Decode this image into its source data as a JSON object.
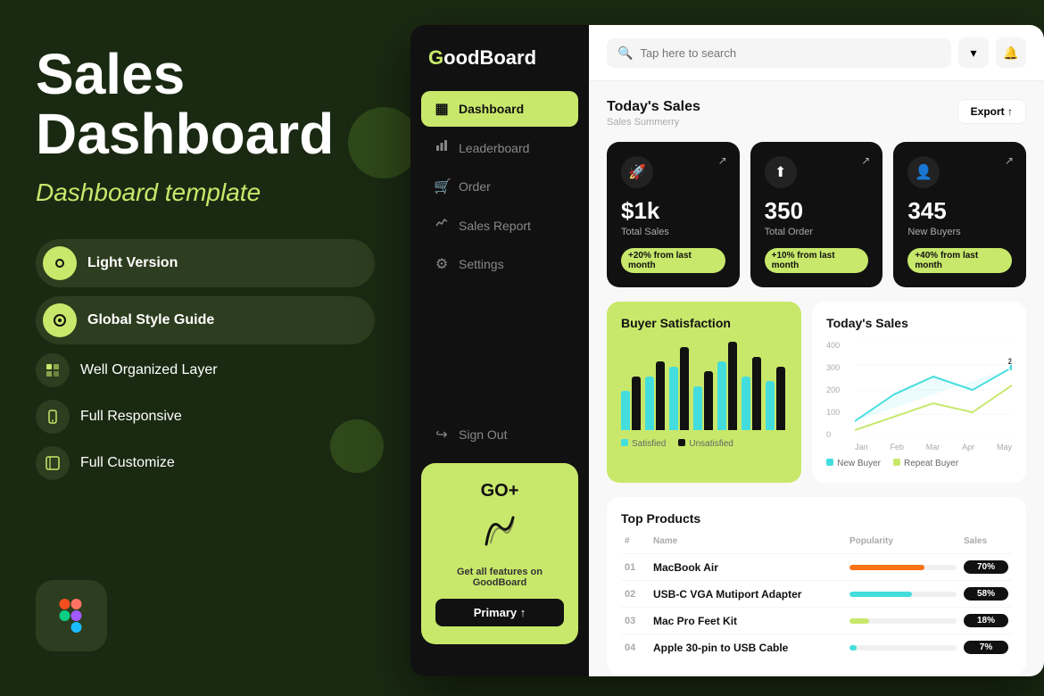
{
  "hero": {
    "title": "Sales\nDashboard",
    "subtitle": "Dashboard template",
    "features": [
      {
        "id": "light-version",
        "label": "Light Version",
        "icon": "⊙",
        "is_button": true
      },
      {
        "id": "global-style",
        "label": "Global Style Guide",
        "icon": "◎",
        "is_button": true
      },
      {
        "id": "organized",
        "label": "Well Organized Layer",
        "icon": "⊞"
      },
      {
        "id": "responsive",
        "label": "Full Responsive",
        "icon": "📱"
      },
      {
        "id": "customize",
        "label": "Full Customize",
        "icon": "⊡"
      }
    ]
  },
  "sidebar": {
    "logo": "GoodBoard",
    "nav_items": [
      {
        "id": "dashboard",
        "label": "Dashboard",
        "icon": "▦",
        "active": true
      },
      {
        "id": "leaderboard",
        "label": "Leaderboard",
        "icon": "📊",
        "active": false
      },
      {
        "id": "order",
        "label": "Order",
        "icon": "🛒",
        "active": false
      },
      {
        "id": "sales-report",
        "label": "Sales Report",
        "icon": "📈",
        "active": false
      },
      {
        "id": "settings",
        "label": "Settings",
        "icon": "⚙",
        "active": false
      }
    ],
    "signout": {
      "label": "Sign Out",
      "icon": "↪"
    },
    "promo": {
      "logo": "GO+",
      "icon": "✦",
      "text": "Get all features on GoodBoard",
      "button_label": "Primary ↑"
    }
  },
  "topbar": {
    "search_placeholder": "Tap here to search"
  },
  "dashboard": {
    "section_title": "Today's Sales",
    "section_sub": "Sales Summerry",
    "export_label": "Export ↑",
    "stats": [
      {
        "id": "total-sales",
        "icon": "🚀",
        "value": "$1k",
        "label": "Total Sales",
        "badge": "+20% from last month"
      },
      {
        "id": "total-order",
        "icon": "⬆",
        "value": "350",
        "label": "Total Order",
        "badge": "+10% from last month"
      },
      {
        "id": "new-buyers",
        "icon": "👤",
        "value": "345",
        "label": "New Buyers",
        "badge": "+40% from last month"
      }
    ],
    "buyer_satisfaction": {
      "title": "Buyer Satisfaction",
      "bars": [
        {
          "dark": 55,
          "teal": 40
        },
        {
          "dark": 70,
          "teal": 55
        },
        {
          "dark": 85,
          "teal": 65
        },
        {
          "dark": 60,
          "teal": 45
        },
        {
          "dark": 90,
          "teal": 70
        },
        {
          "dark": 75,
          "teal": 55
        },
        {
          "dark": 65,
          "teal": 50
        }
      ],
      "legend": [
        {
          "label": "Satisfied",
          "color": "#4dd"
        },
        {
          "label": "Unsatisfied",
          "color": "#111"
        }
      ]
    },
    "todays_sales_chart": {
      "title": "Today's Sales",
      "y_labels": [
        "400",
        "300",
        "200",
        "100",
        "0"
      ],
      "x_labels": [
        "Jan",
        "Feb",
        "Mar",
        "Apr",
        "May"
      ],
      "legend": [
        {
          "label": "New Buyer",
          "color": "#4dd"
        },
        {
          "label": "Repeat Buyer",
          "color": "#c8e86b"
        }
      ]
    },
    "top_products": {
      "title": "Top Products",
      "columns": [
        "#",
        "Name",
        "Popularity",
        "Sales"
      ],
      "rows": [
        {
          "num": "01",
          "name": "MacBook Air",
          "popularity": 70,
          "sales": "70%",
          "color": "#f97316"
        },
        {
          "num": "02",
          "name": "USB-C VGA Mutiport Adapter",
          "popularity": 58,
          "sales": "58%",
          "color": "#4dd"
        },
        {
          "num": "03",
          "name": "Mac Pro Feet Kit",
          "popularity": 18,
          "sales": "18%",
          "color": "#c8e86b"
        },
        {
          "num": "04",
          "name": "Apple 30-pin to USB Cable",
          "popularity": 7,
          "sales": "7%",
          "color": "#4dd"
        }
      ]
    }
  },
  "colors": {
    "accent": "#c8e86b",
    "dark": "#111111",
    "background": "#1a2a12"
  }
}
